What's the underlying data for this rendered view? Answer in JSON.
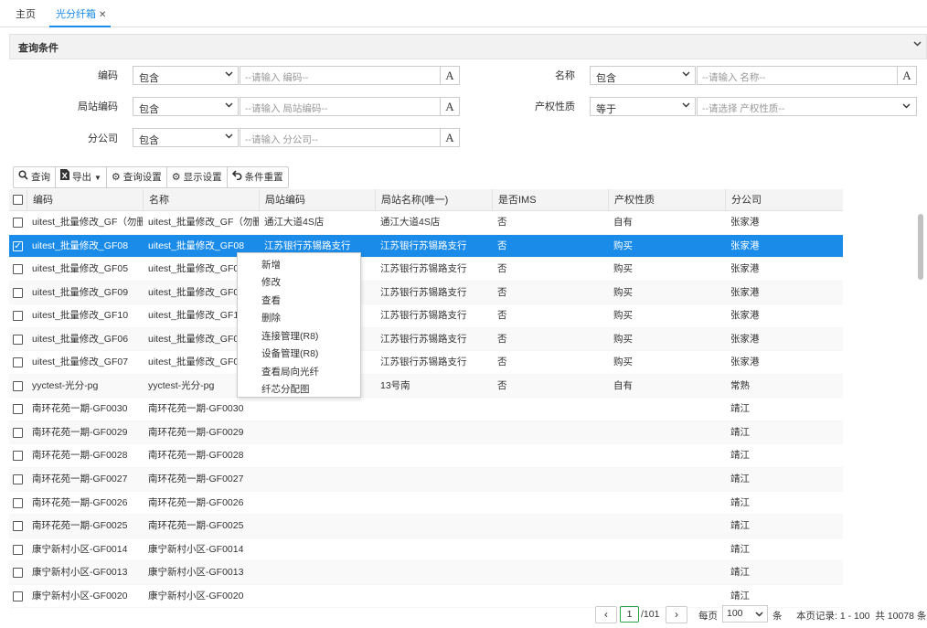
{
  "tabs": [
    {
      "label": "主页"
    },
    {
      "label": "光分纤箱",
      "close": "✕"
    }
  ],
  "query": {
    "title": "查询条件",
    "fields": [
      {
        "label": "编码",
        "op": "包含",
        "placeholder": "--请输入 编码--"
      },
      {
        "label": "局站编码",
        "op": "包含",
        "placeholder": "--请输入 局站编码--"
      },
      {
        "label": "分公司",
        "op": "包含",
        "placeholder": "--请输入 分公司--"
      },
      {
        "label": "名称",
        "op": "包含",
        "placeholder": "--请输入 名称--"
      },
      {
        "label": "产权性质",
        "op": "等于",
        "placeholder": "--请选择 产权性质--"
      }
    ],
    "abtn": "A"
  },
  "toolbar": {
    "query": "查询",
    "export": "导出",
    "query_settings": "查询设置",
    "display_settings": "显示设置",
    "reset": "条件重置"
  },
  "grid": {
    "columns": [
      "编码",
      "名称",
      "局站编码",
      "局站名称(唯一)",
      "是否IMS",
      "产权性质",
      "分公司"
    ],
    "rows": [
      [
        "uitest_批量修改_GF（勿删",
        "uitest_批量修改_GF（勿删",
        "通江大道4S店",
        "通江大道4S店",
        "否",
        "自有",
        "张家港"
      ],
      [
        "uitest_批量修改_GF08",
        "uitest_批量修改_GF08",
        "江苏银行苏锡路支行",
        "江苏银行苏锡路支行",
        "否",
        "购买",
        "张家港"
      ],
      [
        "uitest_批量修改_GF05",
        "uitest_批量修改_GF05",
        "",
        "江苏银行苏锡路支行",
        "否",
        "购买",
        "张家港"
      ],
      [
        "uitest_批量修改_GF09",
        "uitest_批量修改_GF09",
        "",
        "江苏银行苏锡路支行",
        "否",
        "购买",
        "张家港"
      ],
      [
        "uitest_批量修改_GF10",
        "uitest_批量修改_GF10",
        "",
        "江苏银行苏锡路支行",
        "否",
        "购买",
        "张家港"
      ],
      [
        "uitest_批量修改_GF06",
        "uitest_批量修改_GF06",
        "",
        "江苏银行苏锡路支行",
        "否",
        "购买",
        "张家港"
      ],
      [
        "uitest_批量修改_GF07",
        "uitest_批量修改_GF07",
        "",
        "江苏银行苏锡路支行",
        "否",
        "购买",
        "张家港"
      ],
      [
        "yyctest-光分-pg",
        "yyctest-光分-pg",
        "",
        "13号南",
        "否",
        "自有",
        "常熟"
      ],
      [
        "南环花苑一期-GF0030",
        "南环花苑一期-GF0030",
        "",
        "",
        "",
        "",
        "靖江"
      ],
      [
        "南环花苑一期-GF0029",
        "南环花苑一期-GF0029",
        "",
        "",
        "",
        "",
        "靖江"
      ],
      [
        "南环花苑一期-GF0028",
        "南环花苑一期-GF0028",
        "",
        "",
        "",
        "",
        "靖江"
      ],
      [
        "南环花苑一期-GF0027",
        "南环花苑一期-GF0027",
        "",
        "",
        "",
        "",
        "靖江"
      ],
      [
        "南环花苑一期-GF0026",
        "南环花苑一期-GF0026",
        "",
        "",
        "",
        "",
        "靖江"
      ],
      [
        "南环花苑一期-GF0025",
        "南环花苑一期-GF0025",
        "",
        "",
        "",
        "",
        "靖江"
      ],
      [
        "康宁新村小区-GF0014",
        "康宁新村小区-GF0014",
        "",
        "",
        "",
        "",
        "靖江"
      ],
      [
        "康宁新村小区-GF0013",
        "康宁新村小区-GF0013",
        "",
        "",
        "",
        "",
        "靖江"
      ],
      [
        "康宁新村小区-GF0020",
        "康宁新村小区-GF0020",
        "",
        "",
        "",
        "",
        "靖江"
      ]
    ],
    "selected_row": 1
  },
  "context_menu": [
    "新增",
    "修改",
    "查看",
    "删除",
    "连接管理(R8)",
    "设备管理(R8)",
    "查看局向光纤",
    "纤芯分配图"
  ],
  "pager": {
    "page": "1",
    "total_pages": "/101",
    "per_page_label": "每页",
    "per_page": "100",
    "unit": "条",
    "summary": "本页记录: 1 - 100  共 10078 条"
  }
}
